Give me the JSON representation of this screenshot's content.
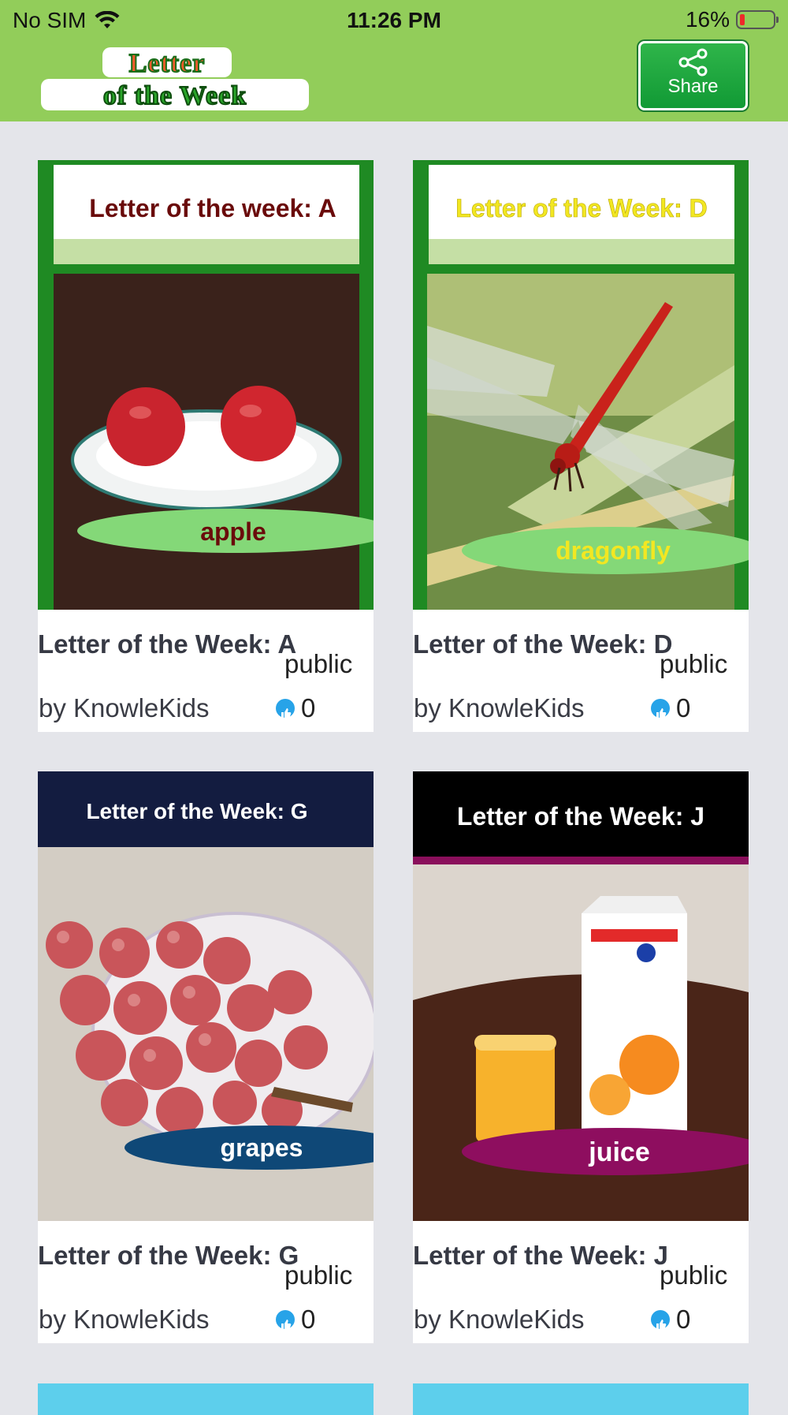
{
  "status_bar": {
    "carrier": "No SIM",
    "time": "11:26 PM",
    "battery": "16%",
    "battery_level": 0.16
  },
  "header": {
    "logo_text_line1": "Letter",
    "logo_text_line2": "of the Week",
    "share_label": "Share",
    "icons": {
      "share": "share-icon",
      "wifi": "wifi-icon",
      "battery": "battery-icon"
    }
  },
  "cards": [
    {
      "thumb_header": "Letter of the week: A",
      "word": "apple",
      "title": "Letter of the Week: A",
      "visibility": "public",
      "author": "by KnowleKids",
      "likes": "0"
    },
    {
      "thumb_header": "Letter of the Week: D",
      "word": "dragonfly",
      "title": "Letter of the Week: D",
      "visibility": "public",
      "author": "by KnowleKids",
      "likes": "0"
    },
    {
      "thumb_header": "Letter of the Week: G",
      "word": "grapes",
      "title": "Letter of the Week: G",
      "visibility": "public",
      "author": "by KnowleKids",
      "likes": "0"
    },
    {
      "thumb_header": "Letter of the Week: J",
      "word": "juice",
      "title": "Letter of the Week: J",
      "visibility": "public",
      "author": "by KnowleKids",
      "likes": "0"
    }
  ],
  "colors": {
    "app_bar": "#92cd5a",
    "background": "#e4e5ea",
    "like_icon": "#27a3e8",
    "share_button": "#1ea83d"
  }
}
